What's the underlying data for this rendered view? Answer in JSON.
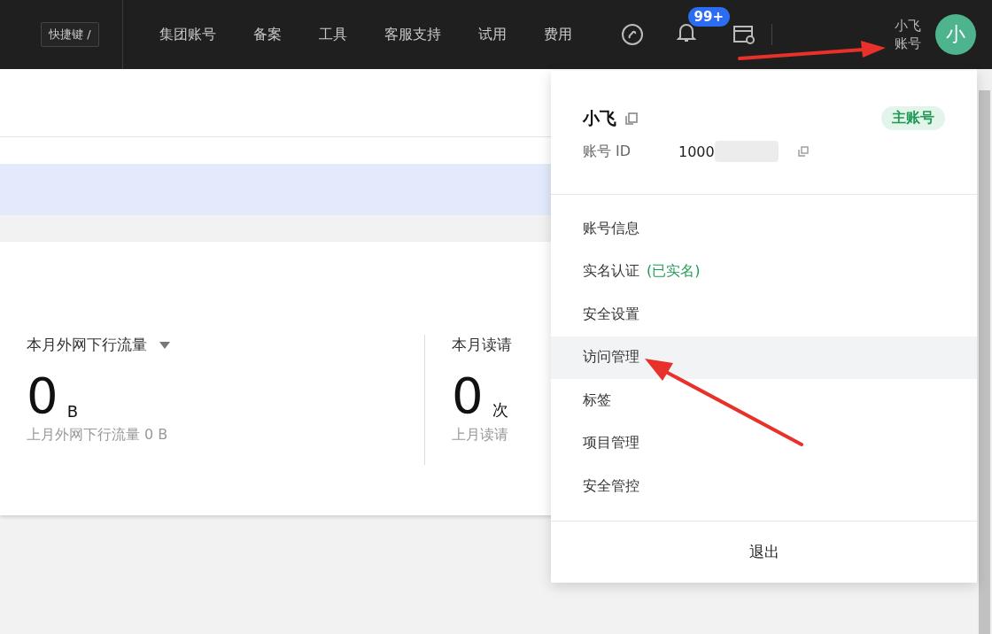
{
  "topbar": {
    "shortcut": "快捷键 /",
    "nav": [
      "集团账号",
      "备案",
      "工具",
      "客服支持",
      "试用",
      "费用"
    ],
    "badge": "99+",
    "user_name": "小飞",
    "user_role": "账号",
    "avatar": "小"
  },
  "stats": [
    {
      "label": "本月外网下行流量",
      "dropdown": true,
      "value": "0",
      "unit": "B",
      "previous": "上月外网下行流量 0 B"
    },
    {
      "label": "本月读请",
      "dropdown": false,
      "value": "0",
      "unit": "次",
      "previous": "上月读请"
    }
  ],
  "account_menu": {
    "name": "小飞",
    "tag": "主账号",
    "id_label": "账号 ID",
    "id_value": "1000",
    "items": [
      {
        "label": "账号信息",
        "selected": false
      },
      {
        "label": "实名认证",
        "note": "(已实名)",
        "selected": false
      },
      {
        "label": "安全设置",
        "selected": false
      },
      {
        "label": "访问管理",
        "selected": true
      },
      {
        "label": "标签",
        "selected": false
      },
      {
        "label": "项目管理",
        "selected": false
      },
      {
        "label": "安全管控",
        "selected": false
      }
    ],
    "logout": "退出"
  }
}
